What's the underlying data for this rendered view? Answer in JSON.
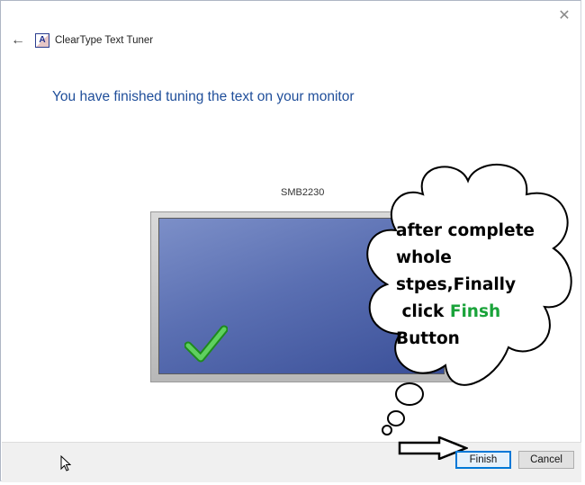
{
  "window": {
    "close_glyph": "✕",
    "back_glyph": "←",
    "app_icon_letter": "A",
    "app_title": "ClearType Text Tuner"
  },
  "main": {
    "heading": "You have finished tuning the text on your monitor",
    "monitor_label": "SMB2230"
  },
  "annotation": {
    "line1": "after complete",
    "line2": "whole",
    "line3": "stpes,Finally",
    "line4_prefix": " click ",
    "line4_highlight": "Finsh",
    "line5": "Button",
    "highlight_color": "#1aa33a"
  },
  "footer": {
    "finish_label": "Finish",
    "cancel_label": "Cancel"
  },
  "colors": {
    "heading": "#1f4e9a",
    "accent": "#0078d7"
  }
}
